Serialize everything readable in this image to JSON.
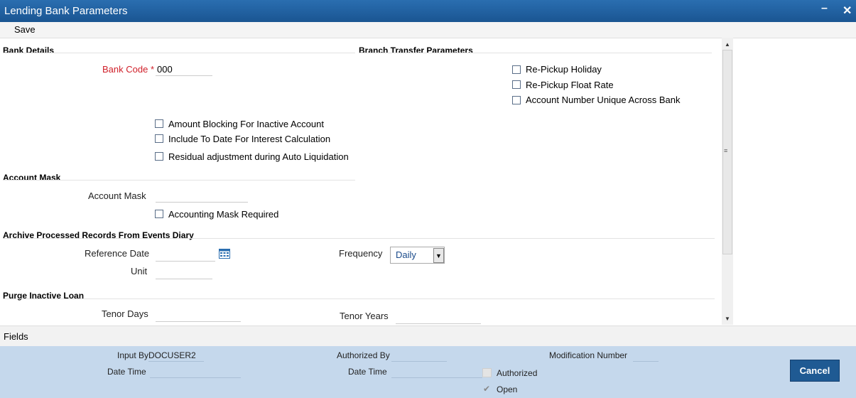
{
  "window": {
    "title": "Lending Bank Parameters",
    "minimize_icon": "minimize-icon",
    "close_icon": "close-icon"
  },
  "toolbar": {
    "save_label": "Save"
  },
  "bank_details": {
    "heading": "Bank Details",
    "bank_code_label": "Bank Code",
    "required_mark": "*",
    "bank_code_value": "000",
    "checkboxes": [
      {
        "label": "Amount Blocking For Inactive Account",
        "checked": false
      },
      {
        "label": "Include To Date For Interest Calculation",
        "checked": false
      },
      {
        "label": "Residual adjustment during Auto Liquidation",
        "checked": false
      }
    ]
  },
  "branch_transfer": {
    "heading": "Branch Transfer Parameters",
    "checkboxes": [
      {
        "label": "Re-Pickup Holiday",
        "checked": false
      },
      {
        "label": "Re-Pickup Float Rate",
        "checked": false
      },
      {
        "label": "Account Number Unique Across Bank",
        "checked": false
      }
    ]
  },
  "account_mask": {
    "heading": "Account Mask",
    "mask_label": "Account Mask",
    "mask_value": "",
    "required_checkbox": {
      "label": "Accounting Mask Required",
      "checked": false
    }
  },
  "archive": {
    "heading": "Archive Processed Records From Events Diary",
    "reference_date_label": "Reference Date",
    "reference_date_value": "",
    "unit_label": "Unit",
    "unit_value": "",
    "frequency_label": "Frequency",
    "frequency_value": "Daily"
  },
  "purge": {
    "heading": "Purge Inactive Loan",
    "tenor_days_label": "Tenor Days",
    "tenor_days_value": "",
    "tenor_years_label": "Tenor Years",
    "tenor_years_value": ""
  },
  "fields_bar": {
    "label": "Fields"
  },
  "audit": {
    "input_by_label": "Input By",
    "input_by_value": "DOCUSER2",
    "date_time_label": "Date Time",
    "authorized_by_label": "Authorized By",
    "auth_date_time_label": "Date Time",
    "modification_number_label": "Modification Number",
    "authorized_label": "Authorized",
    "open_label": "Open",
    "cancel_label": "Cancel"
  }
}
